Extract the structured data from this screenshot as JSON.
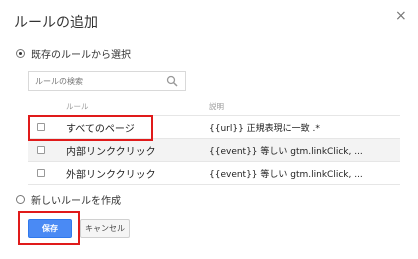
{
  "dialog": {
    "title": "ルールの追加",
    "close_glyph": "×"
  },
  "existing_rule_option": {
    "label": "既存のルールから選択",
    "selected": true
  },
  "search": {
    "placeholder": "ルールの検索",
    "value": ""
  },
  "table": {
    "headers": {
      "rule": "ルール",
      "description": "説明"
    },
    "rows": [
      {
        "name": "すべてのページ",
        "description": "{{url}} 正規表現に一致 .*",
        "checked": false
      },
      {
        "name": "内部リンククリック",
        "description": "{{event}} 等しい gtm.linkClick, ...",
        "checked": false
      },
      {
        "name": "外部リンククリック",
        "description": "{{event}} 等しい gtm.linkClick, ...",
        "checked": false
      }
    ]
  },
  "new_rule_option": {
    "label": "新しいルールを作成",
    "selected": false
  },
  "buttons": {
    "save": "保存",
    "cancel": "キャンセル"
  },
  "colors": {
    "primary_button": "#4a8af4",
    "highlight_box": "#e01a1a"
  },
  "icons": {
    "search": "search-icon",
    "close": "close-icon"
  }
}
